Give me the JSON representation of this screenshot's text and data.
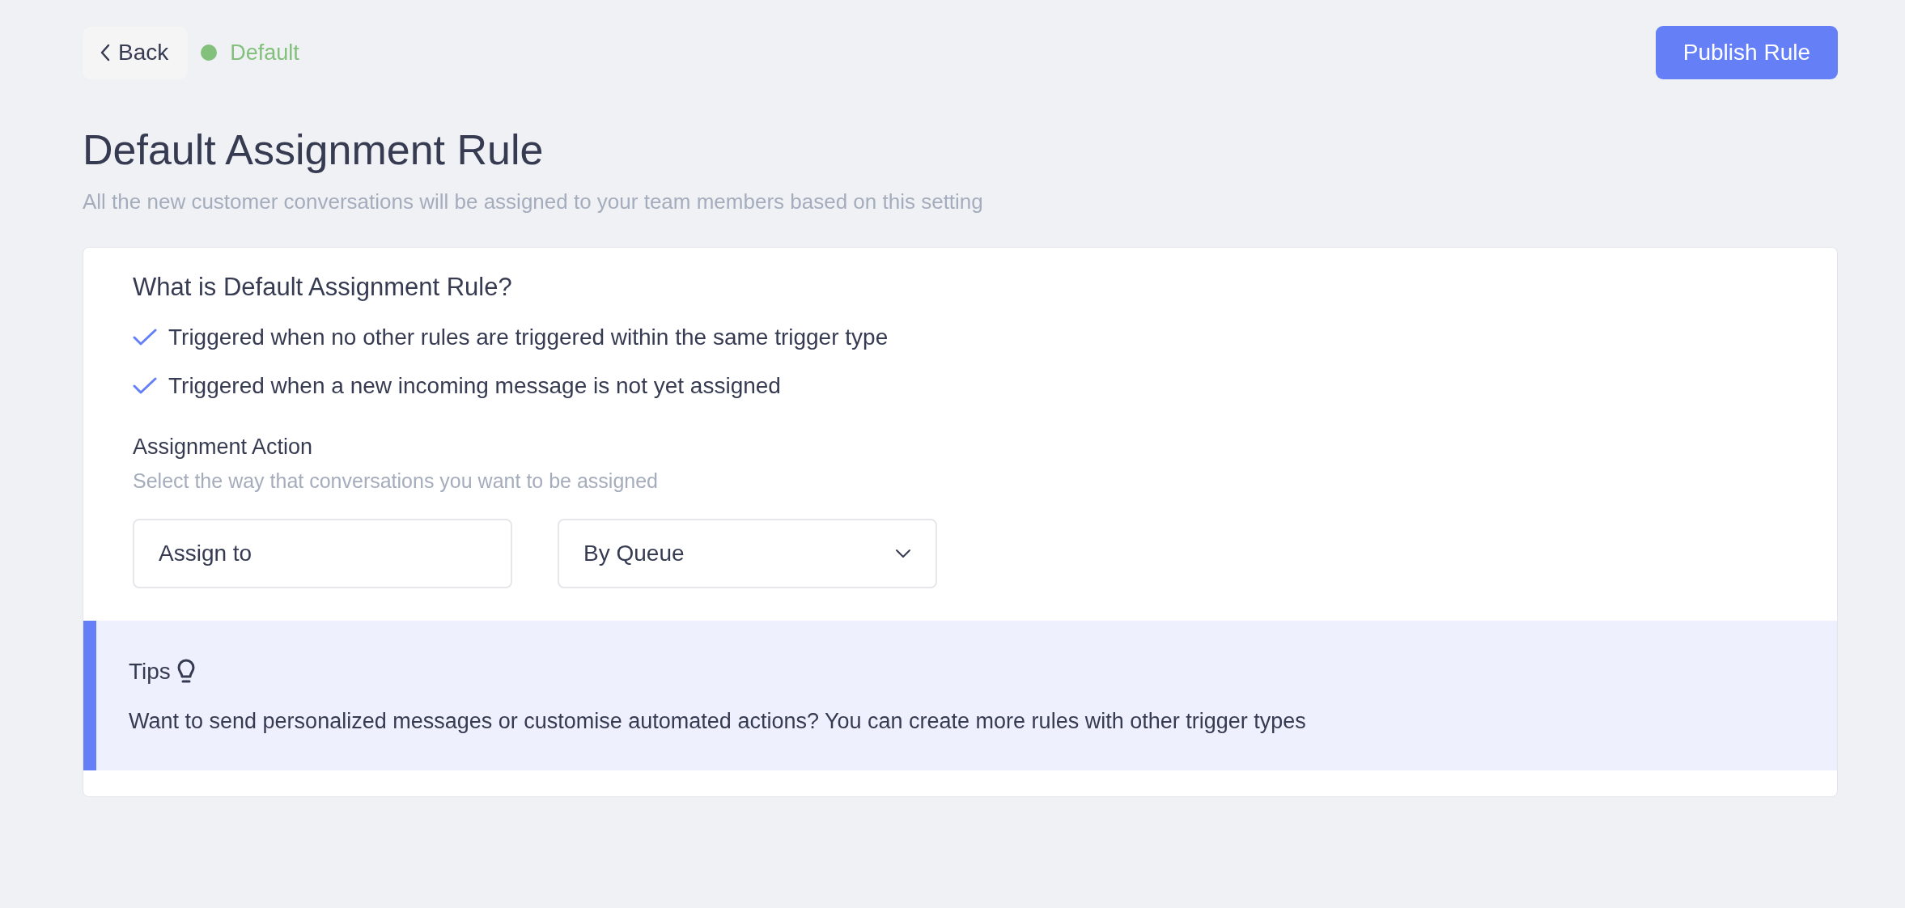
{
  "header": {
    "back_button": "Back",
    "status": {
      "label": "Default",
      "color": "#82c07c"
    },
    "publish_button": "Publish Rule"
  },
  "page": {
    "title": "Default Assignment Rule",
    "subtitle": "All the new customer conversations will be assigned to your team members based on this setting"
  },
  "card": {
    "heading": "What is Default Assignment Rule?",
    "checklist": [
      "Triggered when no other rules are triggered within the same trigger type",
      "Triggered when a new incoming message is not yet assigned"
    ],
    "action": {
      "heading": "Assignment Action",
      "description": "Select the way that conversations you want to be assigned",
      "fields": [
        {
          "kind": "text",
          "value": "Assign to"
        },
        {
          "kind": "dropdown",
          "value": "By Queue"
        }
      ]
    },
    "tips": {
      "title": "Tips",
      "text": "Want to send personalized messages or customise automated actions? You can create more rules with other trigger types"
    }
  }
}
